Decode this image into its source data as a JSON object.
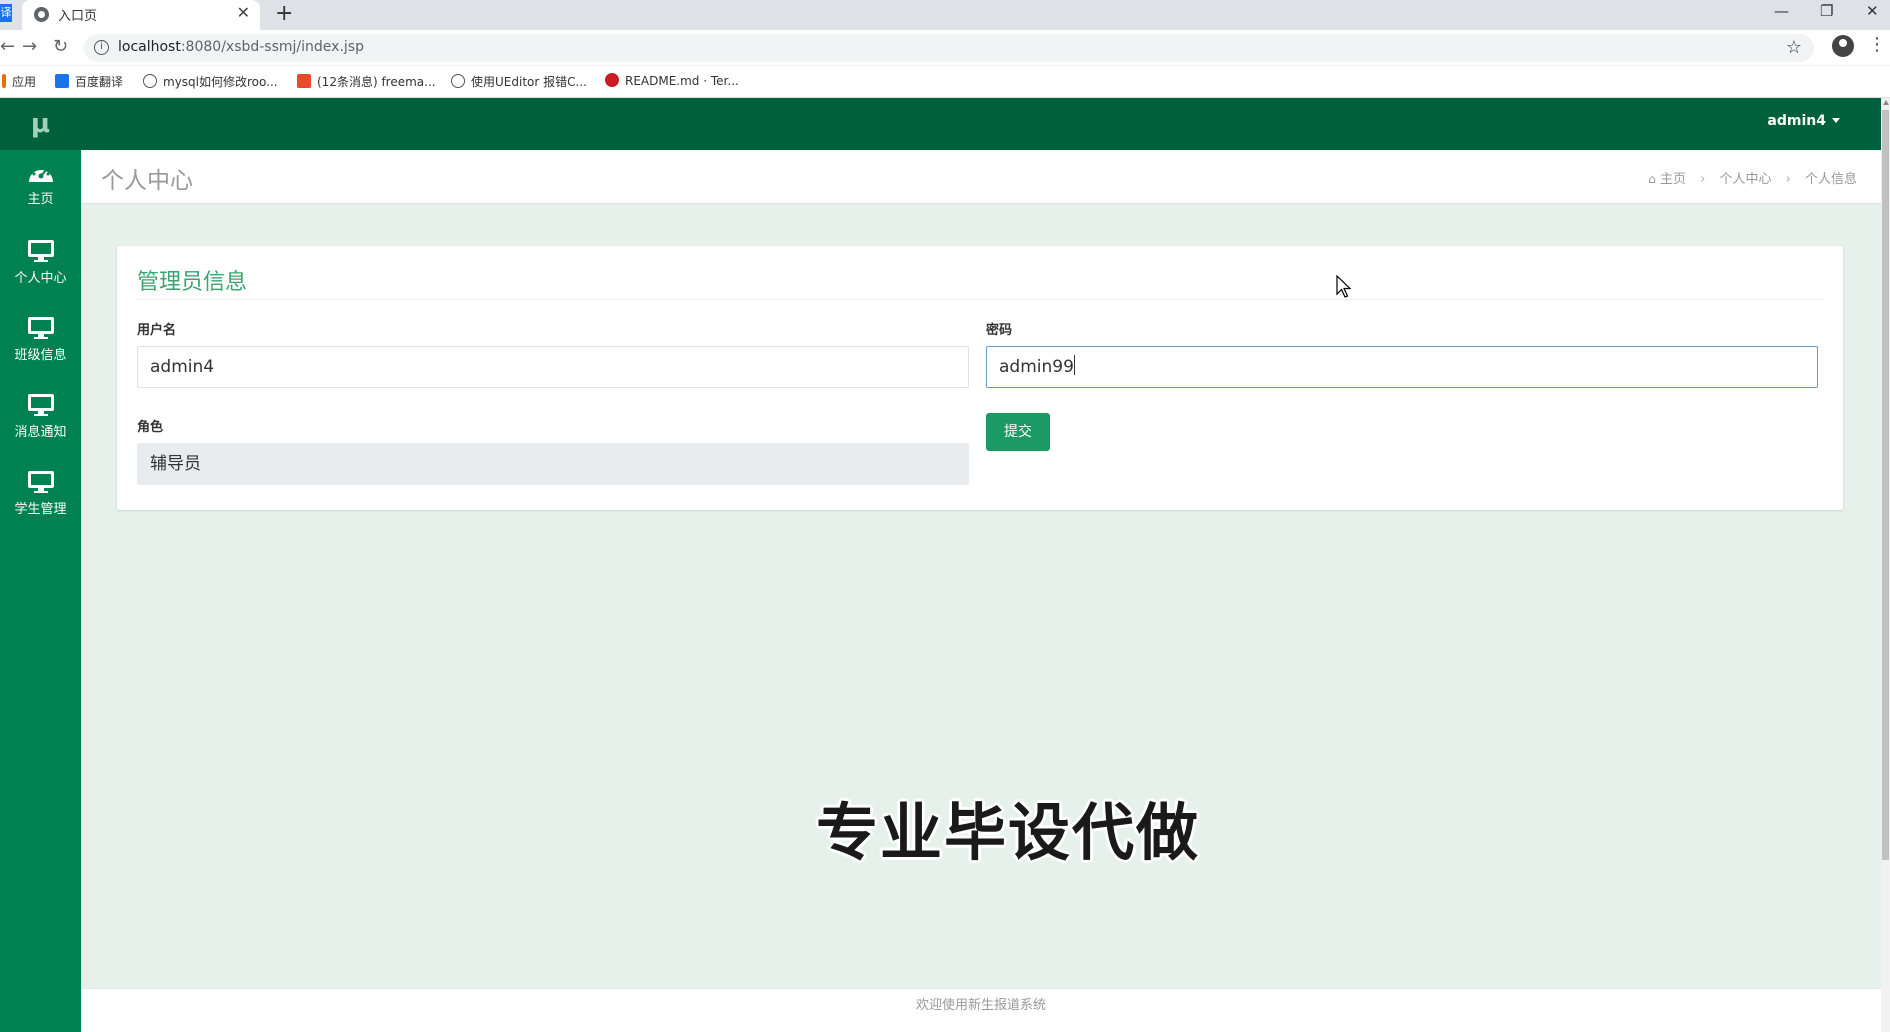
{
  "browser": {
    "tab_title": "入口页",
    "tab_side_glyph": "译",
    "url_host": "localhost",
    "url_path": ":8080/xsbd-ssmj/index.jsp",
    "bookmarks": [
      {
        "label": "应用",
        "icon": "apps-icon",
        "color": "#e8710a"
      },
      {
        "label": "百度翻译",
        "icon": "translate-icon",
        "color": "#1a73e8"
      },
      {
        "label": "mysql如何修改roo...",
        "icon": "bookmark-icon",
        "color": "#555555"
      },
      {
        "label": "(12条消息) freema...",
        "icon": "csdn-icon",
        "color": "#e8492b"
      },
      {
        "label": "使用UEditor 报错C...",
        "icon": "bookmark-icon",
        "color": "#555555"
      },
      {
        "label": "README.md · Ter...",
        "icon": "gitee-icon",
        "color": "#c71d23"
      }
    ]
  },
  "app": {
    "logo": "μ",
    "user": "admin4",
    "sidebar": [
      {
        "label": "主页",
        "icon": "dashboard-icon"
      },
      {
        "label": "个人中心",
        "icon": "monitor-icon"
      },
      {
        "label": "班级信息",
        "icon": "monitor-icon"
      },
      {
        "label": "消息通知",
        "icon": "monitor-icon"
      },
      {
        "label": "学生管理",
        "icon": "monitor-icon"
      }
    ],
    "page_title": "个人中心",
    "breadcrumb": [
      "主页",
      "个人中心",
      "个人信息"
    ],
    "form": {
      "title": "管理员信息",
      "username_label": "用户名",
      "username_value": "admin4",
      "password_label": "密码",
      "password_value": "admin99",
      "role_label": "角色",
      "role_value": "辅导员",
      "submit_label": "提交"
    },
    "watermark": "专业毕设代做",
    "footer": "欢迎使用新生报道系统"
  },
  "colors": {
    "sidebar": "#008151",
    "topbar": "#005f3c",
    "accent": "#3da36f",
    "button": "#1b9b63",
    "content_bg": "#e6f1ec"
  }
}
